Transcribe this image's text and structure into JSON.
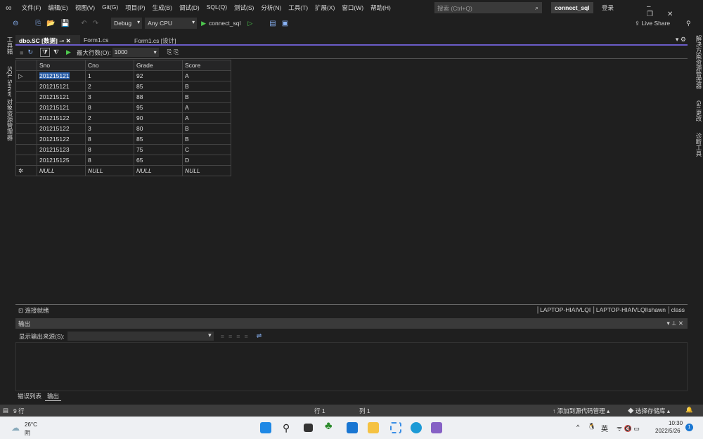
{
  "menu": [
    "文件(F)",
    "编辑(E)",
    "视图(V)",
    "Git(G)",
    "项目(P)",
    "生成(B)",
    "调试(D)",
    "SQL(Q)",
    "测试(S)",
    "分析(N)",
    "工具(T)",
    "扩展(X)",
    "窗口(W)",
    "帮助(H)"
  ],
  "search_placeholder": "搜索 (Ctrl+Q)",
  "project_name": "connect_sql",
  "login": "登录",
  "toolbar": {
    "config": "Debug",
    "platform": "Any CPU",
    "run": "connect_sql",
    "live_share": "Live Share"
  },
  "left_tabs": [
    "工具箱",
    "SQL Server 对象资源管理器"
  ],
  "right_tabs": [
    "解决方案资源管理器",
    "Git 更改",
    "诊断工具"
  ],
  "doc_tabs": [
    "dbo.SC [数据]",
    "Form1.cs",
    "Form1.cs [设计]"
  ],
  "grid_toolbar": {
    "max_rows_label": "最大行数(O):",
    "max_rows": "1000"
  },
  "grid": {
    "columns": [
      "Sno",
      "Cno",
      "Grade",
      "Score"
    ],
    "rows": [
      [
        "201215121",
        "1",
        "92",
        "A"
      ],
      [
        "201215121",
        "2",
        "85",
        "B"
      ],
      [
        "201215121",
        "3",
        "88",
        "B"
      ],
      [
        "201215121",
        "8",
        "95",
        "A"
      ],
      [
        "201215122",
        "2",
        "90",
        "A"
      ],
      [
        "201215122",
        "3",
        "80",
        "B"
      ],
      [
        "201215122",
        "8",
        "85",
        "B"
      ],
      [
        "201215123",
        "8",
        "75",
        "C"
      ],
      [
        "201215125",
        "8",
        "65",
        "D"
      ],
      [
        "NULL",
        "NULL",
        "NULL",
        "NULL"
      ]
    ]
  },
  "conn": {
    "status": "连接就绪",
    "server": "LAPTOP-HIAIVLQI",
    "user": "LAPTOP-HIAIVLQI\\shawn",
    "db": "class"
  },
  "output": {
    "title": "输出",
    "source_label": "显示输出来源(S):",
    "tabs": [
      "错误列表",
      "输出"
    ]
  },
  "status": {
    "rows": "9 行",
    "line": "行 1",
    "col": "列 1",
    "add_source": "添加到源代码管理",
    "select_repo": "选择存储库"
  },
  "taskbar": {
    "temp": "26°C",
    "weather": "阴",
    "ime": "英",
    "time": "10:30",
    "date": "2022/5/26",
    "notif": "1"
  }
}
